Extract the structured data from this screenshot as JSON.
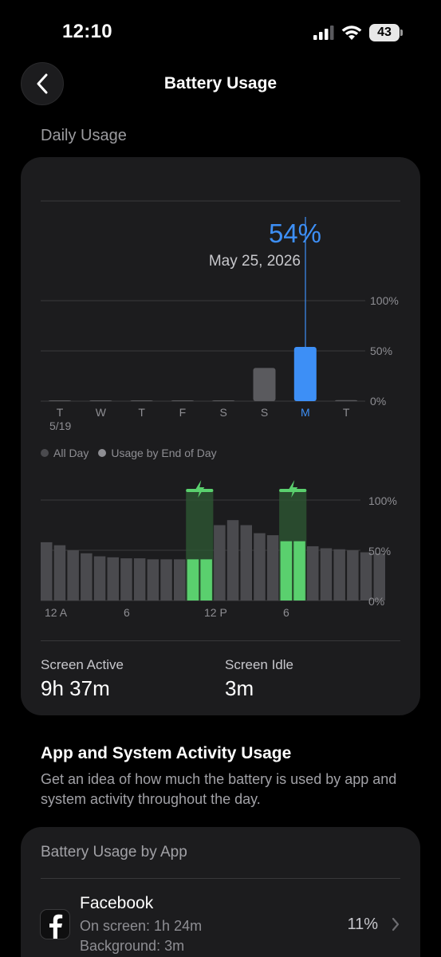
{
  "status_bar": {
    "time": "12:10",
    "battery_level": "43",
    "icons": [
      "signal-icon",
      "wifi-icon",
      "battery-icon"
    ]
  },
  "nav": {
    "title": "Battery Usage",
    "back_icon": "chevron-left-icon"
  },
  "daily_usage": {
    "section_label": "Daily Usage",
    "tooltip": {
      "value": "54%",
      "date": "May 25, 2026"
    },
    "y_ticks": [
      "100%",
      "50%",
      "0%"
    ],
    "days": [
      "T",
      "W",
      "T",
      "F",
      "S",
      "S",
      "M",
      "T"
    ],
    "first_date": "5/19",
    "selected_day_index": 6,
    "values": [
      0,
      0,
      0,
      0,
      0,
      33,
      54,
      1
    ],
    "bar_colors": {
      "normal": "#5a5a5e",
      "selected": "#3d8ff6"
    }
  },
  "legend": {
    "all_day": "All Day",
    "end_of_day": "Usage by End of Day"
  },
  "hourly_usage": {
    "x_labels": [
      "12 A",
      "6",
      "12 P",
      "6"
    ],
    "y_ticks": [
      "100%",
      "50%",
      "0%"
    ],
    "values": [
      58,
      55,
      50,
      47,
      44,
      43,
      42,
      42,
      41,
      41,
      41,
      41,
      41,
      75,
      80,
      75,
      67,
      65,
      59,
      59,
      54,
      52,
      51,
      50,
      48,
      47
    ],
    "charging_hours": [
      11,
      12,
      18,
      19
    ],
    "colors": {
      "normal": "#4a4a4e",
      "charging": "#5ad06e",
      "charging_band": "#2e5a34"
    }
  },
  "screen_time": {
    "active_label": "Screen Active",
    "active_value": "9h 37m",
    "idle_label": "Screen Idle",
    "idle_value": "3m"
  },
  "activity": {
    "title": "App and System Activity Usage",
    "description": "Get an idea of how much the battery is used by app and system activity throughout the day."
  },
  "apps": {
    "card_title": "Battery Usage by App",
    "items": [
      {
        "name": "Facebook",
        "on_screen": "On screen: 1h 24m",
        "background": "Background: 3m",
        "percent": "11%",
        "icon": "facebook-icon"
      }
    ]
  }
}
